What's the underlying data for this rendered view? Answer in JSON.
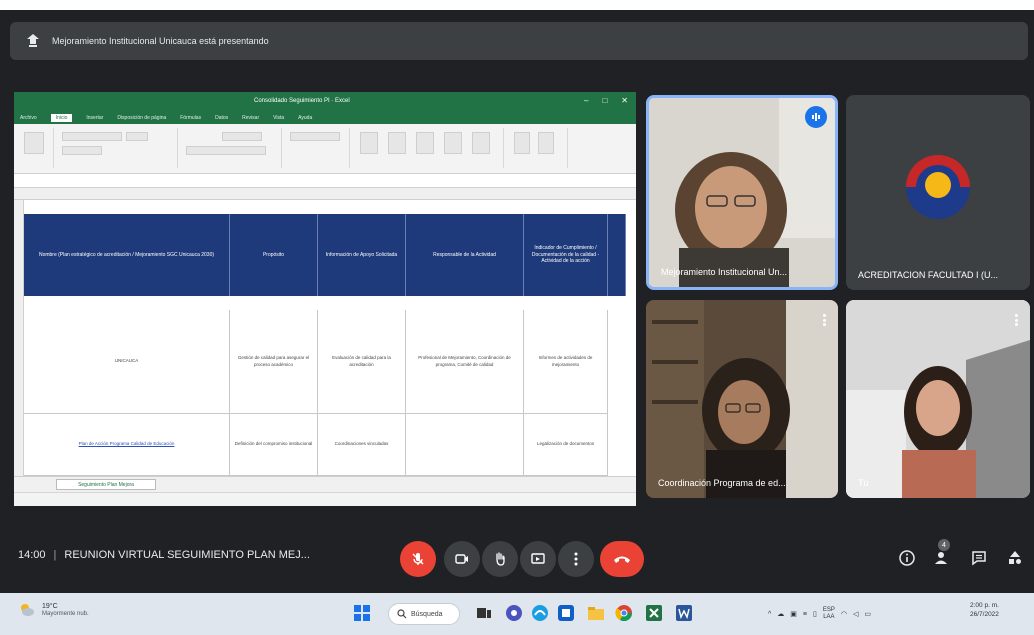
{
  "banner": {
    "text": "Mejoramiento Institucional Unicauca está presentando"
  },
  "excel": {
    "title": "Consolidado Seguimiento PI · Excel",
    "menu": [
      "Archivo",
      "Inicio",
      "Insertar",
      "Disposición de página",
      "Fórmulas",
      "Datos",
      "Revisar",
      "Vista",
      "Ayuda"
    ],
    "headers": [
      "Nombre (Plan estratégico de acreditación / Mejoramiento SGC Unicauca 2030)",
      "Propósito",
      "Información de Apoyo Solicitada",
      "Responsable de la Actividad",
      "Indicador de Cumplimiento / Documentación de la calidad - Actividad de la acción"
    ],
    "sheet_tab": "Seguimiento Plan Mejora",
    "rows": [
      {
        "c1": "UNICAUCA",
        "c2": "Gestión de calidad para asegurar el proceso académico",
        "c3": "Evaluación de calidad para la acreditación",
        "c4": "Profesional de Mejoramiento, Coordinación de programa, Comité de calidad",
        "c5": "Informes de actividades de mejoramiento"
      },
      {
        "c1": "Plan de Acción Programa Calidad de Educación",
        "c2": "Definición del compromiso institucional",
        "c3": "Coordinaciones vinculadas",
        "c4": "",
        "c5": "Legalización de documentos"
      }
    ]
  },
  "participants": [
    {
      "name": "Mejoramiento Institucional Un...",
      "speaking": true
    },
    {
      "name": "ACREDITACION FACULTAD I (U..."
    },
    {
      "name": "Coordinación Programa de ed..."
    },
    {
      "name": "Tú"
    }
  ],
  "meeting": {
    "time": "14:00",
    "separator": "|",
    "title": "REUNION VIRTUAL SEGUIMIENTO PLAN MEJ...",
    "participant_count": "4"
  },
  "taskbar": {
    "weather_temp": "19°C",
    "weather_cond": "Mayormente nub.",
    "search_placeholder": "Búsqueda",
    "lang": "ESP",
    "lang_sub": "LAA",
    "time": "2:00 p. m.",
    "date": "26/7/2022"
  },
  "colors": {
    "excel_green": "#217346",
    "table_header_blue": "#1f3a7a",
    "end_call_red": "#ea4335",
    "speaking_blue": "#1a73e8"
  }
}
